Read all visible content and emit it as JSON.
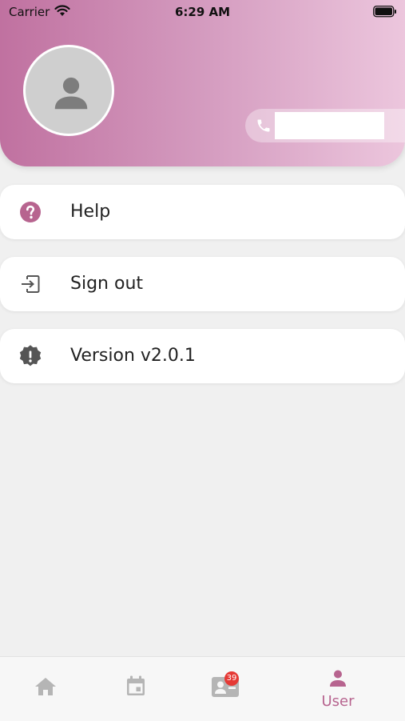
{
  "status_bar": {
    "carrier": "Carrier",
    "time": "6:29 AM"
  },
  "profile": {
    "avatar_icon": "person-icon",
    "phone_icon": "phone-icon",
    "phone_value": ""
  },
  "menu": [
    {
      "label": "Help",
      "icon": "help-circle-icon"
    },
    {
      "label": "Sign out",
      "icon": "sign-out-icon"
    },
    {
      "label": "Version v2.0.1",
      "icon": "alert-badge-icon"
    }
  ],
  "tabbar": {
    "tabs": [
      {
        "icon": "home-icon",
        "label": ""
      },
      {
        "icon": "calendar-icon",
        "label": ""
      },
      {
        "icon": "contact-card-icon",
        "label": "",
        "badge": "39"
      },
      {
        "icon": "user-icon",
        "label": "User",
        "active": true
      }
    ]
  },
  "colors": {
    "accent": "#b7648f",
    "inactive": "#b5b5b5",
    "badge": "#e53935",
    "header_start": "#c071a0",
    "header_end": "#ecc6dd"
  }
}
